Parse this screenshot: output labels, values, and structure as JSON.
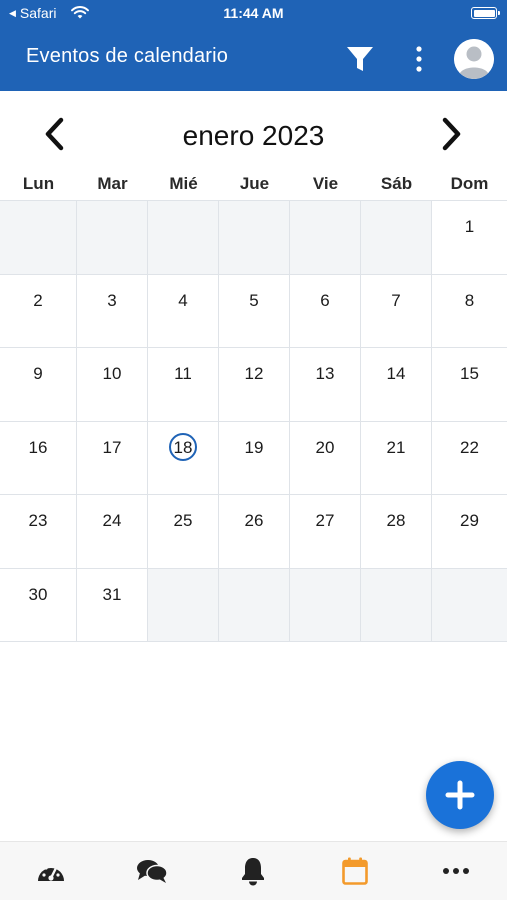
{
  "status_bar": {
    "back_app": "Safari",
    "time": "11:44 AM"
  },
  "app_bar": {
    "title": "Eventos de calendario",
    "icons": [
      "filter-icon",
      "more-vertical-icon",
      "user-avatar-icon"
    ]
  },
  "calendar": {
    "month_title": "enero 2023",
    "weekdays": [
      "Lun",
      "Mar",
      "Mié",
      "Jue",
      "Vie",
      "Sáb",
      "Dom"
    ],
    "weeks": [
      [
        "",
        "",
        "",
        "",
        "",
        "",
        "1"
      ],
      [
        "2",
        "3",
        "4",
        "5",
        "6",
        "7",
        "8"
      ],
      [
        "9",
        "10",
        "11",
        "12",
        "13",
        "14",
        "15"
      ],
      [
        "16",
        "17",
        "18",
        "19",
        "20",
        "21",
        "22"
      ],
      [
        "23",
        "24",
        "25",
        "26",
        "27",
        "28",
        "29"
      ],
      [
        "30",
        "31",
        "",
        "",
        "",
        "",
        ""
      ]
    ],
    "today": "18"
  },
  "fab": {
    "icon": "plus-icon"
  },
  "bottom_nav": {
    "tabs": [
      {
        "icon": "dashboard-gauge-icon",
        "active": false
      },
      {
        "icon": "chat-bubbles-icon",
        "active": false
      },
      {
        "icon": "bell-icon",
        "active": false
      },
      {
        "icon": "calendar-icon",
        "active": true
      },
      {
        "icon": "more-horizontal-icon",
        "active": false
      }
    ]
  },
  "colors": {
    "primary": "#1f63b6",
    "fab": "#1a72d9",
    "active_tab": "#f39a2b",
    "empty_cell": "#f3f5f7"
  }
}
